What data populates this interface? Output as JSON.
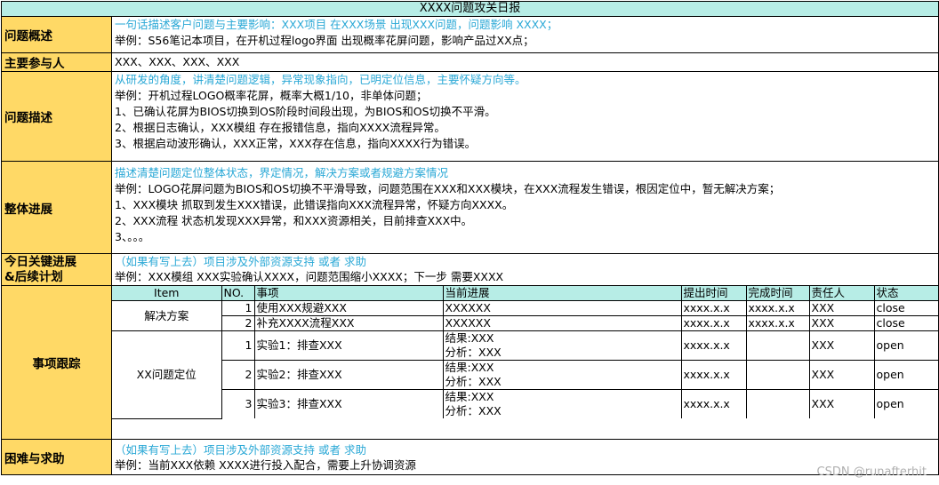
{
  "title": "XXXX问题攻关日报",
  "sections": {
    "overview": {
      "label": "问题概述",
      "lines": [
        "一句话描述客户问题与主要影响：XXX项目 在XXX场景 出现XXX问题，问题影响 XXXX；",
        "举例：S56笔记本项目，在开机过程logo界面 出现概率花屏问题，影响产品过XX点；"
      ]
    },
    "participants": {
      "label": "主要参与人",
      "value": "XXX、XXX、XXX、XXX"
    },
    "description": {
      "label": "问题描述",
      "lines": [
        "从研发的角度，讲清楚问题逻辑，异常现象指向，已明定位信息，主要怀疑方向等。",
        "举例：开机过程LOGO概率花屏，概率大概1/10，非单体问题；",
        "1、已确认花屏为BIOS切换到OS阶段时间段出现，为BIOS和OS切换不平滑。",
        "2、根据日志确认，XXX模组 存在报错信息，指向XXXX流程异常。",
        "3、根据启动波形确认，XXX正常，XXX存在信息，指向XXXX行为错误。"
      ]
    },
    "progress": {
      "label": "整体进展",
      "lines": [
        "描述清楚问题定位整体状态，界定情况，解决方案或者规避方案情况",
        "举例：LOGO花屏问题为BIOS和OS切换不平滑导致，问题范围在XXX和XXX模块，在XXX流程发生错误，根因定位中，暂无解决方案；",
        "1、XXX模块 抓取到发生XXX错误，此错误指向XXX流程异常，怀疑方向XXXX。",
        "2、XXX流程 状态机发现XXX异常，和XXX资源相关，目前排查XXX中。",
        "3、。。。"
      ]
    },
    "today": {
      "label_line1": "今日关键进展",
      "label_line2": "&后续计划",
      "lines": [
        "（如果有写上去）项目涉及外部资源支持 或者 求助",
        "举例：XXX模组 XXX实验确认XXXX，问题范围缩小XXXX；下一步 需要XXXX"
      ]
    },
    "tracking": {
      "label": "事项跟踪",
      "headers": [
        "Item",
        "NO.",
        "事项",
        "当前进展",
        "提出时间",
        "完成时间",
        "责任人",
        "状态"
      ],
      "groups": [
        {
          "item": "解决方案",
          "rows": [
            {
              "no": "1",
              "task": "使用XXX规避XXX",
              "progress": [
                "XXXXXX"
              ],
              "proposed": "xxxx.x.x",
              "done": "xxxx.x.x",
              "owner": "XXX",
              "status": "close"
            },
            {
              "no": "2",
              "task": "补充XXXX流程XXX",
              "progress": [
                "XXXXXX"
              ],
              "proposed": "xxxx.x.x",
              "done": "xxxx.x.x",
              "owner": "XXX",
              "status": "close"
            }
          ]
        },
        {
          "item": "XX问题定位",
          "rows": [
            {
              "no": "1",
              "task": "实验1：排查XXX",
              "progress": [
                "结果:XXX",
                "分析：XXX"
              ],
              "proposed": "xxxx.x.x",
              "done": "",
              "owner": "XXX",
              "status": "open"
            },
            {
              "no": "2",
              "task": "实验2：排查XXX",
              "progress": [
                "结果:XXX",
                "分析：XXX"
              ],
              "proposed": "xxxx.x.x",
              "done": "",
              "owner": "XXX",
              "status": "open"
            },
            {
              "no": "3",
              "task": "实验3：排查XXX",
              "progress": [
                "结果:XXX",
                "分析：XXX"
              ],
              "proposed": "xxxx.x.x",
              "done": "",
              "owner": "XXX",
              "status": "open"
            }
          ]
        }
      ]
    },
    "help": {
      "label": "困难与求助",
      "lines": [
        "（如果有写上去）项目涉及外部资源支持 或者 求助",
        "举例：当前XXX依赖 XXXX进行投入配合，需要上升协调资源"
      ]
    }
  },
  "watermark": "CSDN @runafterhit",
  "colors": {
    "header_bg": "#b7ede6",
    "label_bg": "#ffd966",
    "hint_text": "#2aa8d6"
  }
}
